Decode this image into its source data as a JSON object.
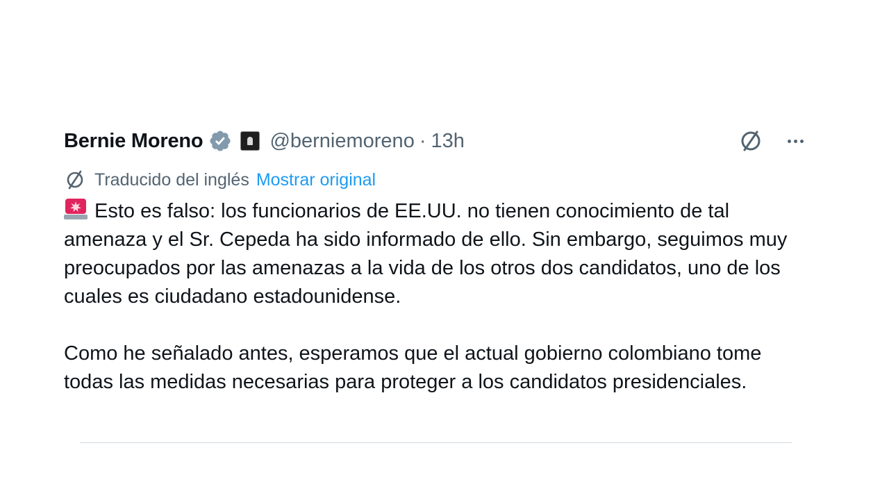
{
  "tweet": {
    "author": {
      "name": "Bernie Moreno",
      "handle": "@berniemoreno",
      "separator": "·",
      "time": "13h"
    },
    "translation": {
      "label": "Traducido del inglés",
      "show_original": "Mostrar original"
    },
    "paragraphs": [
      "Esto es falso: los funcionarios de EE.UU. no tienen conocimiento de tal amenaza y el Sr. Cepeda ha sido informado de ello. Sin embargo, seguimos muy preocupados por las amenazas a la vida de los otros dos candidatos, uno de los cuales es ciudadano estadounidense.",
      "Como he señalado antes, esperamos que el actual gobierno colombiano tome todas las medidas necesarias para proteger a los candidatos presidenciales."
    ],
    "icons": {
      "verified": "verified-badge-icon",
      "affiliate": "affiliate-badge-icon",
      "grok": "grok-icon",
      "more": "more-icon",
      "translate": "translate-icon",
      "siren": "rotating-light-icon"
    },
    "colors": {
      "link": "#1d9bf0",
      "secondary_text": "#536471",
      "verified_badge": "#829aab",
      "siren": "#e0245e"
    }
  }
}
